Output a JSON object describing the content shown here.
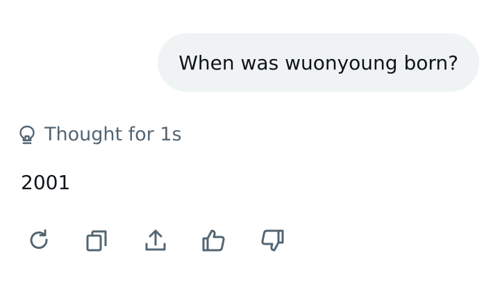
{
  "conversation": {
    "user_message": "When was wuonyoung born?",
    "thought_label": "Thought for 1s",
    "answer": "2001"
  },
  "icons": {
    "thought": "lightbulb-icon",
    "actions": [
      "regenerate-icon",
      "copy-icon",
      "share-icon",
      "thumbs-up-icon",
      "thumbs-down-icon"
    ]
  },
  "colors": {
    "bubble_bg": "#eff3f4",
    "primary_text": "#0f1419",
    "secondary_text": "#536471",
    "icon": "#536471"
  }
}
